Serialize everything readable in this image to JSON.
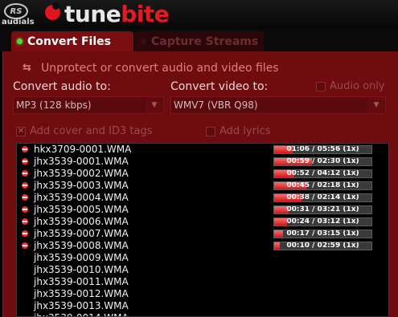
{
  "header": {
    "audials_logo": "RS",
    "audials_label": "audials",
    "brand_part1": "tune",
    "brand_part2": "bite"
  },
  "tabs": [
    {
      "label": "Convert Files",
      "active": true
    },
    {
      "label": "Capture Streams",
      "active": false
    }
  ],
  "panel": {
    "unprotect_label": "Unprotect or convert audio and video files",
    "audio_label": "Convert audio to:",
    "audio_value": "MP3 (128 kbps)",
    "video_label": "Convert video to:",
    "video_value": "WMV7 (VBR Q98)",
    "audio_only_label": "Audio only",
    "add_cover_label": "Add cover and ID3 tags",
    "add_lyrics_label": "Add lyrics"
  },
  "files": [
    {
      "name": "hkx3709-0001.WMA",
      "progress_text": "01:06 / 05:56 (1x)",
      "progress": 0.19
    },
    {
      "name": "jhx3539-0001.WMA",
      "progress_text": "00:59 / 02:30 (1x)",
      "progress": 0.39
    },
    {
      "name": "jhx3539-0002.WMA",
      "progress_text": "00:52 / 04:12 (1x)",
      "progress": 0.21
    },
    {
      "name": "jhx3539-0003.WMA",
      "progress_text": "00:45 / 02:18 (1x)",
      "progress": 0.33
    },
    {
      "name": "jhx3539-0004.WMA",
      "progress_text": "00:38 / 02:14 (1x)",
      "progress": 0.28
    },
    {
      "name": "jhx3539-0005.WMA",
      "progress_text": "00:31 / 03:21 (1x)",
      "progress": 0.15
    },
    {
      "name": "jhx3539-0006.WMA",
      "progress_text": "00:24 / 03:12 (1x)",
      "progress": 0.13
    },
    {
      "name": "jhx3539-0007.WMA",
      "progress_text": "00:17 / 03:15 (1x)",
      "progress": 0.09
    },
    {
      "name": "jhx3539-0008.WMA",
      "progress_text": "00:10 / 02:59 (1x)",
      "progress": 0.06
    },
    {
      "name": "jhx3539-0009.WMA"
    },
    {
      "name": "jhx3539-0010.WMA"
    },
    {
      "name": "jhx3539-0011.WMA"
    },
    {
      "name": "jhx3539-0012.WMA"
    },
    {
      "name": "jhx3539-0013.WMA"
    },
    {
      "name": "jhx3539-0014.WMA"
    }
  ]
}
